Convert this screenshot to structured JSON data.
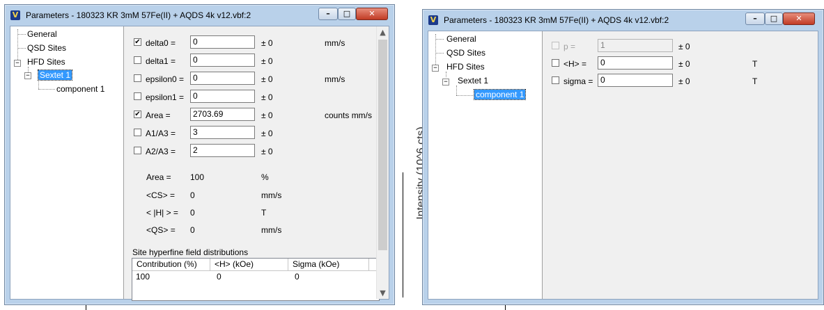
{
  "background": {
    "chart_axis_label": "Intensity (10^6 cts)"
  },
  "window1": {
    "title": "Parameters - 180323 KR 3mM 57Fe(II) + AQDS 4k v12.vbf:2",
    "tree": {
      "general": "General",
      "qsd_sites": "QSD Sites",
      "hfd_sites": "HFD Sites",
      "sextet1": "Sextet 1",
      "component1": "component 1"
    },
    "params": [
      {
        "label": "delta0 =",
        "checked": true,
        "value": "0",
        "pm": "±  0",
        "unit": "mm/s"
      },
      {
        "label": "delta1 =",
        "checked": false,
        "value": "0",
        "pm": "±  0",
        "unit": ""
      },
      {
        "label": "epsilon0 =",
        "checked": false,
        "value": "0",
        "pm": "±  0",
        "unit": "mm/s"
      },
      {
        "label": "epsilon1 =",
        "checked": false,
        "value": "0",
        "pm": "±  0",
        "unit": ""
      },
      {
        "label": "Area =",
        "checked": true,
        "value": "2703.69",
        "pm": "±  0",
        "unit": "counts mm/s"
      },
      {
        "label": "A1/A3 =",
        "checked": false,
        "value": "3",
        "pm": "±  0",
        "unit": ""
      },
      {
        "label": "A2/A3 =",
        "checked": false,
        "value": "2",
        "pm": "±  0",
        "unit": ""
      }
    ],
    "stats": [
      {
        "label": "Area =",
        "value": "100",
        "unit": "%"
      },
      {
        "label": "<CS> =",
        "value": "0",
        "unit": "mm/s"
      },
      {
        "label": "< |H| > =",
        "value": "0",
        "unit": "T"
      },
      {
        "label": "<QS> =",
        "value": "0",
        "unit": "mm/s"
      }
    ],
    "distributions": {
      "caption": "Site hyperfine field distributions",
      "columns": [
        "Contribution (%)",
        "<H> (kOe)",
        "Sigma (kOe)"
      ],
      "rows": [
        [
          "100",
          "0",
          "0"
        ]
      ]
    }
  },
  "window2": {
    "title": "Parameters - 180323 KR 3mM 57Fe(II) + AQDS 4k v12.vbf:2",
    "tree": {
      "general": "General",
      "qsd_sites": "QSD Sites",
      "hfd_sites": "HFD Sites",
      "sextet1": "Sextet 1",
      "component1": "component 1"
    },
    "params": [
      {
        "label": "p =",
        "checked": false,
        "disabled": true,
        "value": "1",
        "pm": "±  0",
        "unit": ""
      },
      {
        "label": "<H> =",
        "checked": false,
        "disabled": false,
        "value": "0",
        "pm": "±  0",
        "unit": "T"
      },
      {
        "label": "sigma =",
        "checked": false,
        "disabled": false,
        "value": "0",
        "pm": "±  0",
        "unit": "T"
      }
    ]
  }
}
